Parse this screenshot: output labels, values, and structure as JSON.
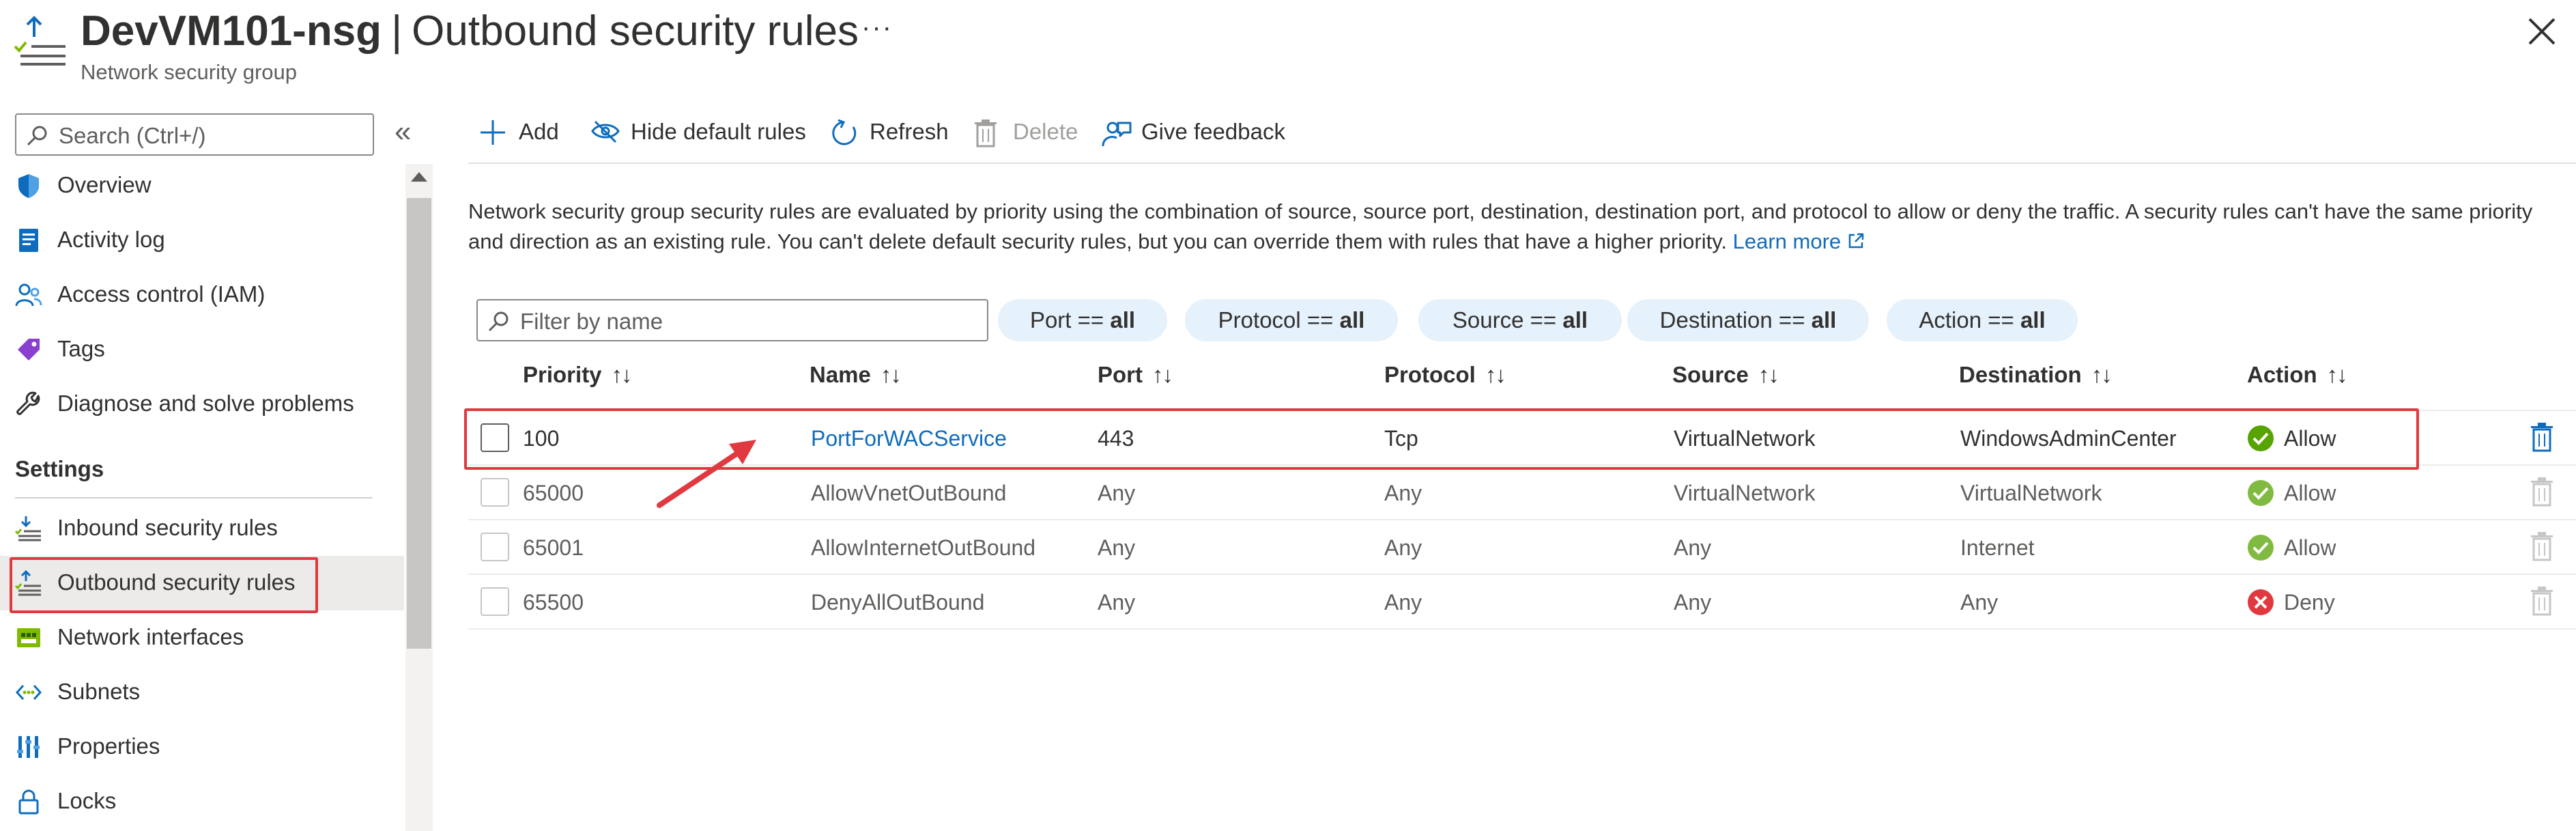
{
  "header": {
    "resource": "DevVM101-nsg",
    "separator": "|",
    "page": "Outbound security rules",
    "subtitle": "Network security group",
    "more": "···"
  },
  "sidebar": {
    "search_placeholder": "Search (Ctrl+/)",
    "collapse": "«",
    "section_settings": "Settings",
    "items": [
      {
        "label": "Overview",
        "icon": "shield-icon"
      },
      {
        "label": "Activity log",
        "icon": "activity-log-icon"
      },
      {
        "label": "Access control (IAM)",
        "icon": "people-icon"
      },
      {
        "label": "Tags",
        "icon": "tag-icon"
      },
      {
        "label": "Diagnose and solve problems",
        "icon": "wrench-icon"
      },
      {
        "label": "Inbound security rules",
        "icon": "inbound-rules-icon"
      },
      {
        "label": "Outbound security rules",
        "icon": "outbound-rules-icon",
        "selected": true
      },
      {
        "label": "Network interfaces",
        "icon": "network-interface-icon"
      },
      {
        "label": "Subnets",
        "icon": "subnet-icon"
      },
      {
        "label": "Properties",
        "icon": "properties-icon"
      },
      {
        "label": "Locks",
        "icon": "lock-icon"
      }
    ]
  },
  "toolbar": {
    "add": "Add",
    "hide_default": "Hide default rules",
    "refresh": "Refresh",
    "delete": "Delete",
    "feedback": "Give feedback"
  },
  "description": {
    "text": "Network security group security rules are evaluated by priority using the combination of source, source port, destination, destination port, and protocol to allow or deny the traffic. A security rules can't have the same priority and direction as an existing rule. You can't delete default security rules, but you can override them with rules that have a higher priority.",
    "link": "Learn more"
  },
  "filters": {
    "placeholder": "Filter by name",
    "pills": [
      {
        "key": "Port == ",
        "value": "all"
      },
      {
        "key": "Protocol == ",
        "value": "all"
      },
      {
        "key": "Source == ",
        "value": "all"
      },
      {
        "key": "Destination == ",
        "value": "all"
      },
      {
        "key": "Action == ",
        "value": "all"
      }
    ]
  },
  "table": {
    "columns": [
      "Priority",
      "Name",
      "Port",
      "Protocol",
      "Source",
      "Destination",
      "Action"
    ],
    "sort_glyph": "↑↓",
    "rows": [
      {
        "priority": "100",
        "name": "PortForWACService",
        "port": "443",
        "protocol": "Tcp",
        "source": "VirtualNetwork",
        "destination": "WindowsAdminCenter",
        "action": "Allow"
      },
      {
        "priority": "65000",
        "name": "AllowVnetOutBound",
        "port": "Any",
        "protocol": "Any",
        "source": "VirtualNetwork",
        "destination": "VirtualNetwork",
        "action": "Allow"
      },
      {
        "priority": "65001",
        "name": "AllowInternetOutBound",
        "port": "Any",
        "protocol": "Any",
        "source": "Any",
        "destination": "Internet",
        "action": "Allow"
      },
      {
        "priority": "65500",
        "name": "DenyAllOutBound",
        "port": "Any",
        "protocol": "Any",
        "source": "Any",
        "destination": "Any",
        "action": "Deny"
      }
    ]
  },
  "colors": {
    "accent": "#0f6cbd",
    "allow": "#57a300",
    "deny": "#e0393f",
    "highlight": "#e0393f"
  }
}
